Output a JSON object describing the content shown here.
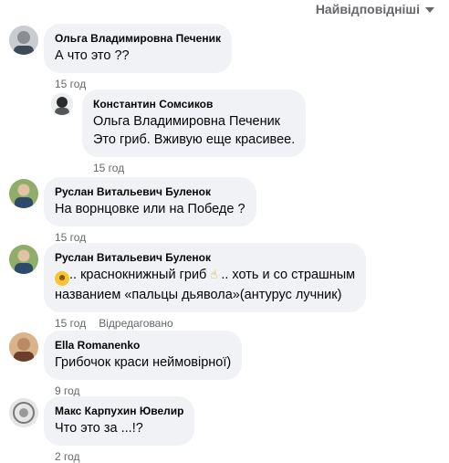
{
  "sort": {
    "label": "Найвідповідніші"
  },
  "comments": [
    {
      "name": "Ольга Владимировна Печеник",
      "text": "А что это ??",
      "time": "15 год"
    },
    {
      "name": "Константин Сомсиков",
      "line1": "Ольга Владимировна Печеник",
      "line2": "Это гриб. Вживую еще красивее.",
      "time": "15 год"
    },
    {
      "name": "Руслан Витальевич Буленок",
      "text": "На ворнцовке или на Победе ?",
      "time": "15 год"
    },
    {
      "name": "Руслан Витальевич Буленок",
      "text_a": ".. краснокнижный гриб ",
      "text_b": " .. хоть и со страшным",
      "line2": "названием «пальцы дьявола»(антурус лучник)",
      "time": "15 год",
      "edited": "Відредаговано",
      "emoji1": "laughing-emoji-icon",
      "emoji2": "pointing-hand-emoji-icon"
    },
    {
      "name": "Ella Romanenko",
      "text": "Грибочок краси неймовірної)",
      "time": "9 год"
    },
    {
      "name": "Макс Карпухин Ювелир",
      "text": "Что это за ...!?",
      "time": "2 год"
    }
  ]
}
